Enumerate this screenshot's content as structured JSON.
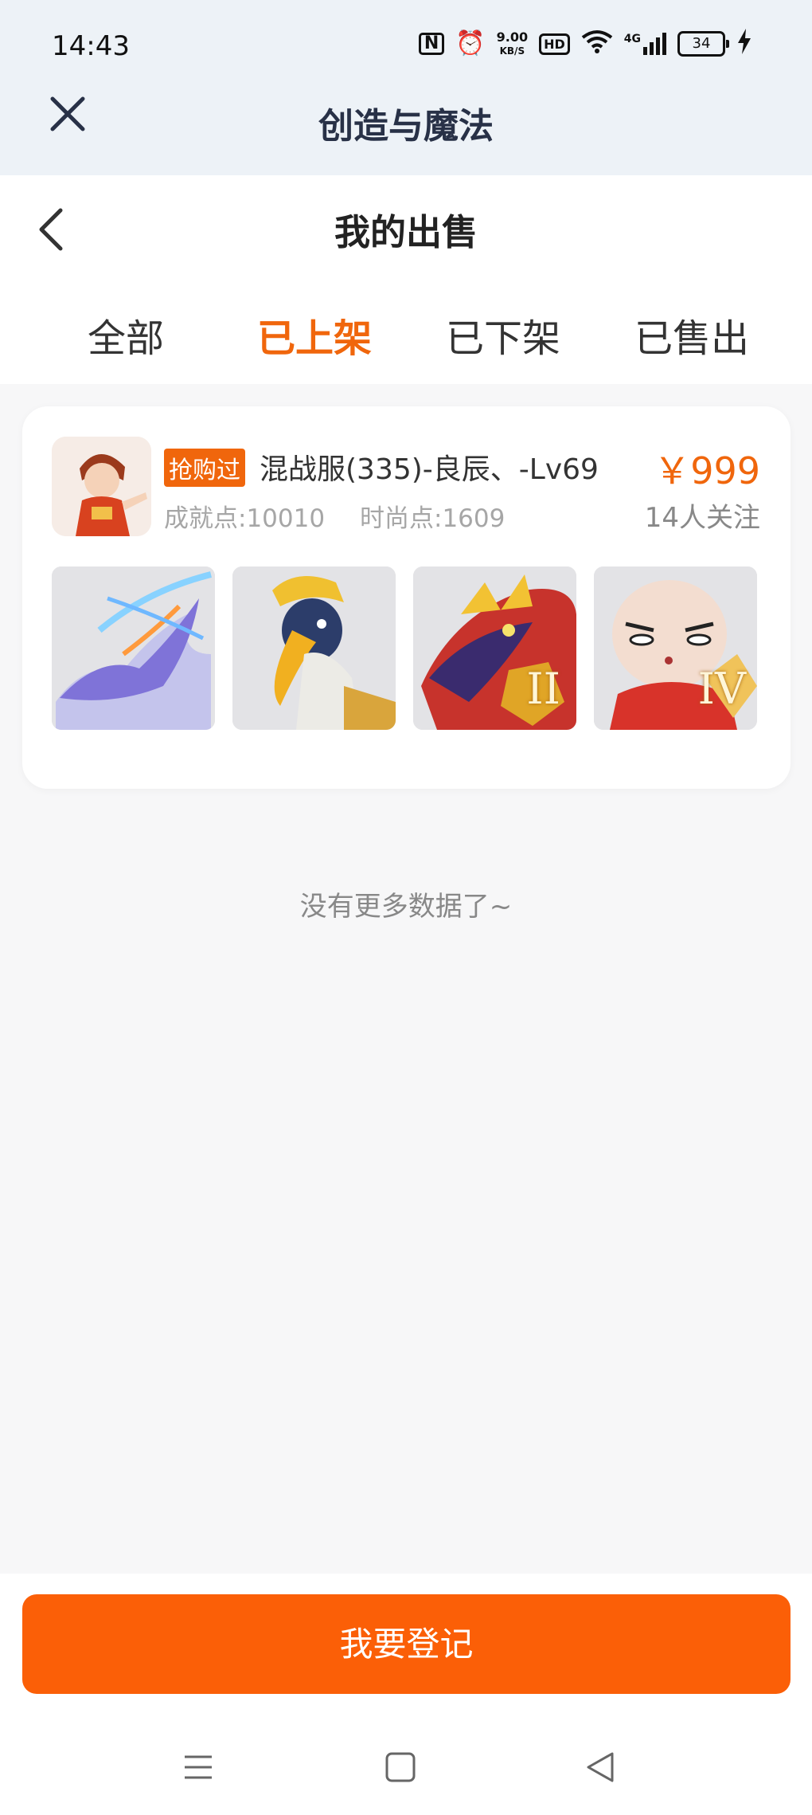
{
  "status_bar": {
    "time": "14:43",
    "net_speed_value": "9.00",
    "net_speed_unit": "KB/S",
    "hd_label": "HD",
    "network_label": "4G",
    "battery_level": "34"
  },
  "app": {
    "title": "创造与魔法"
  },
  "page": {
    "title": "我的出售"
  },
  "tabs": [
    {
      "label": "全部",
      "active": false
    },
    {
      "label": "已上架",
      "active": true
    },
    {
      "label": "已下架",
      "active": false
    },
    {
      "label": "已售出",
      "active": false
    }
  ],
  "listing": {
    "badge": "抢购过",
    "name": "混战服(335)-良辰、-Lv69",
    "price": "￥999",
    "achievement": "成就点:10010",
    "fashion": "时尚点:1609",
    "followers": "14人关注",
    "thumbnails": [
      {
        "icon": "blue-dragon-mount-icon",
        "tier": ""
      },
      {
        "icon": "hornbill-bird-icon",
        "tier": ""
      },
      {
        "icon": "gold-red-dragon-icon",
        "tier": "II"
      },
      {
        "icon": "bald-cartoon-character-icon",
        "tier": "IV"
      }
    ]
  },
  "empty_text": "没有更多数据了~",
  "register_button": "我要登记",
  "colors": {
    "accent": "#f0660c",
    "button": "#fb5f07",
    "header_bg": "#edf2f7"
  }
}
